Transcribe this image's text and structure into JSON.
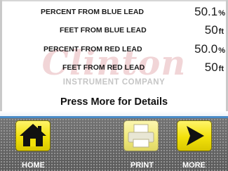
{
  "readings": [
    {
      "label": "PERCENT FROM BLUE LEAD",
      "value": "50.1",
      "unit": "%"
    },
    {
      "label": "FEET FROM BLUE LEAD",
      "value": "50",
      "unit": "ft"
    },
    {
      "label": "PERCENT FROM RED LEAD",
      "value": "50.0",
      "unit": "%"
    },
    {
      "label": "FEET FROM RED LEAD",
      "value": "50",
      "unit": "ft"
    }
  ],
  "watermark": {
    "brand": "Clinton",
    "company": "INSTRUMENT COMPANY"
  },
  "prompt": "Press More for Details",
  "toolbar": {
    "home": {
      "label": "HOME",
      "icon": "home-icon"
    },
    "print": {
      "label": "PRINT",
      "icon": "printer-icon"
    },
    "more": {
      "label": "MORE",
      "icon": "arrow-right-icon"
    }
  },
  "colors": {
    "accent_yellow": "#f2e10a",
    "divider_blue": "#4a8bc6",
    "toolbar_gray": "#6b6b6b"
  }
}
